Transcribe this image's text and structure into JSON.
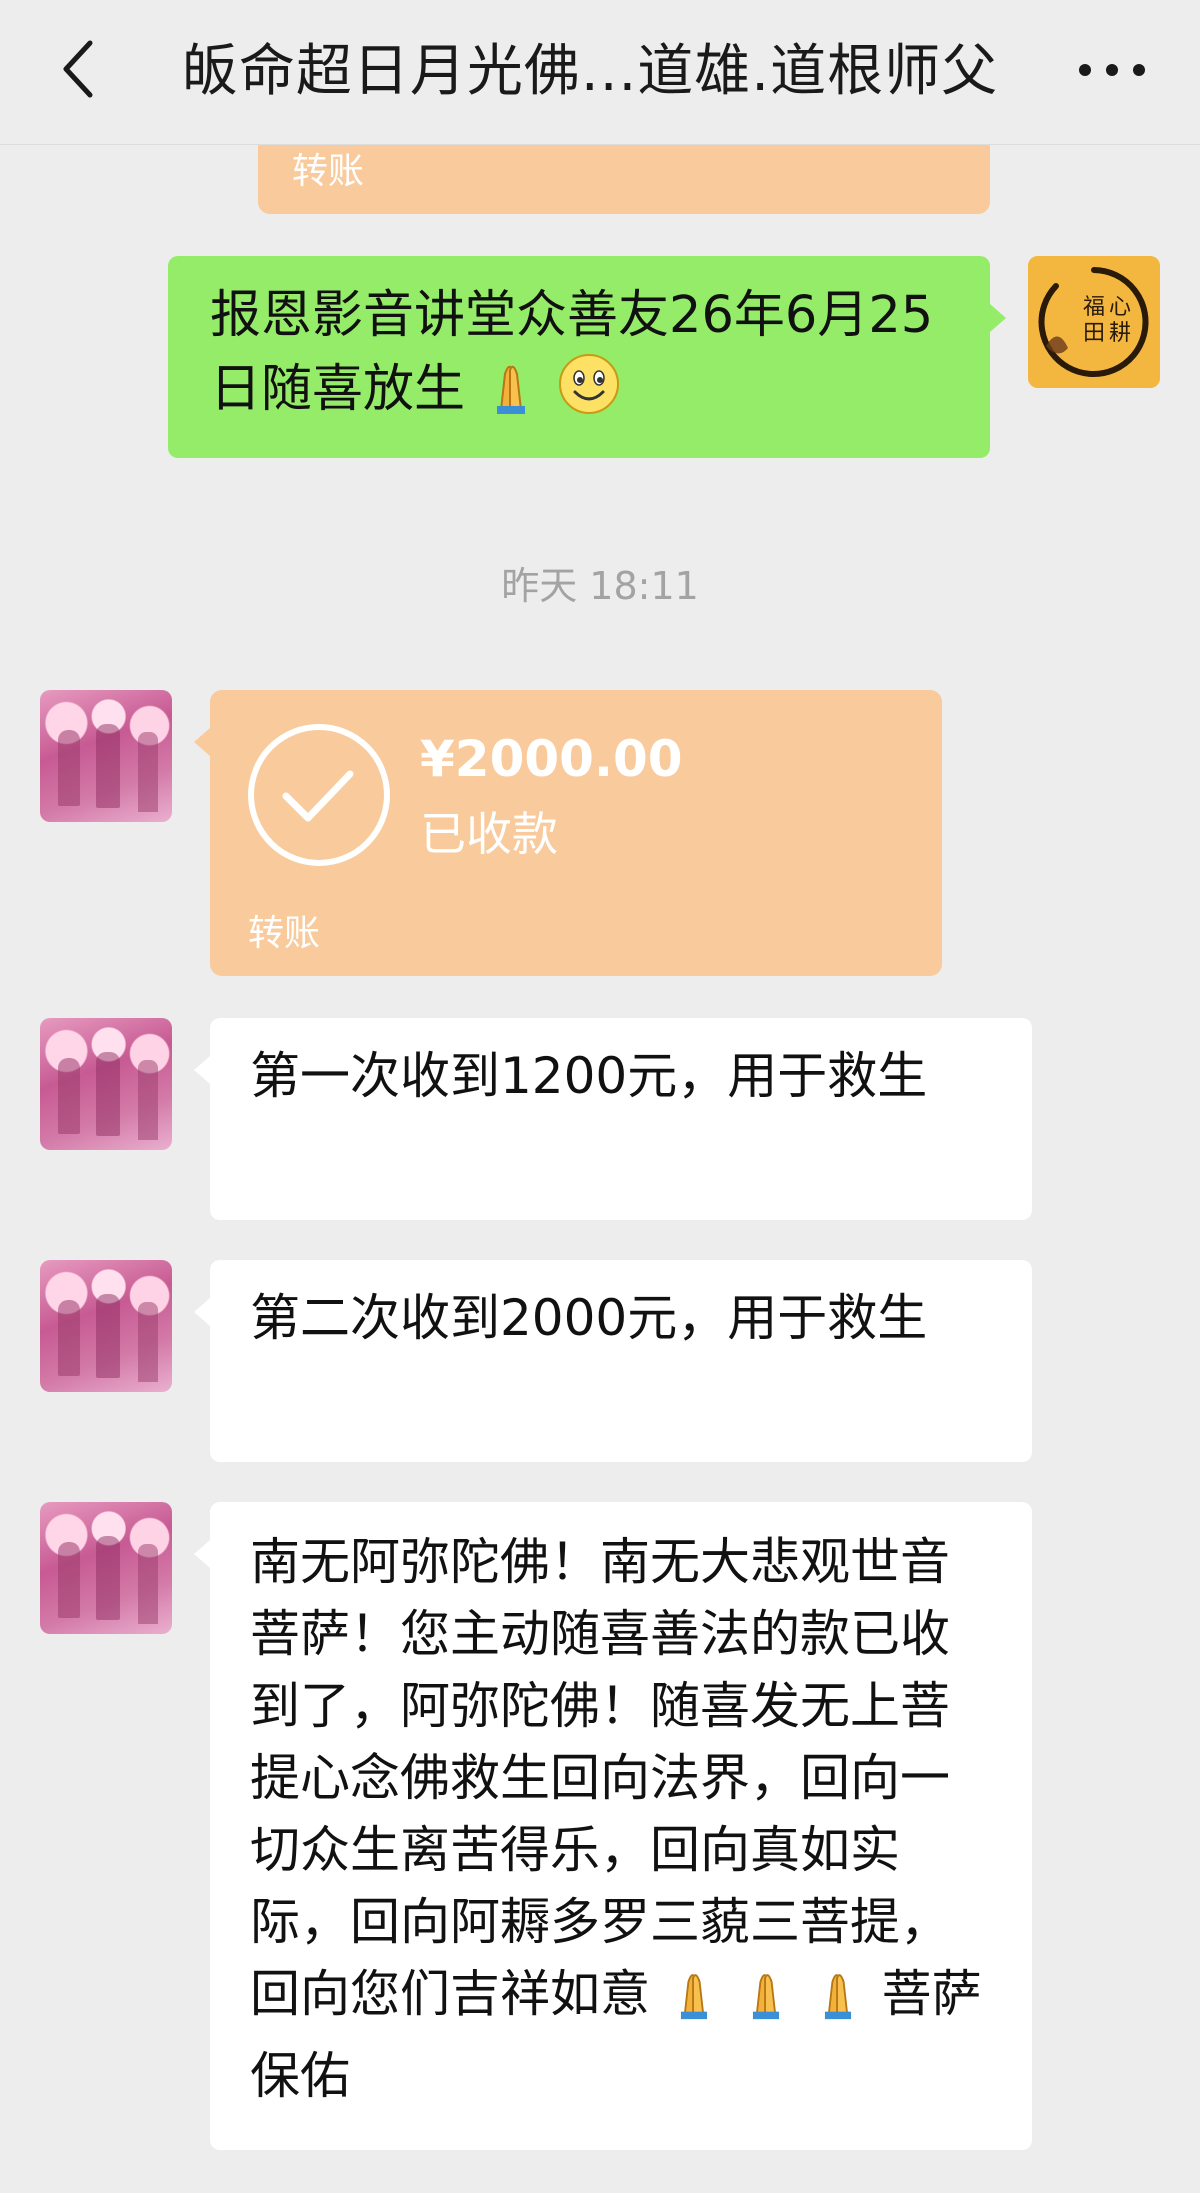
{
  "header": {
    "title": "皈命超日月光佛...道雄.道根师父"
  },
  "messages": {
    "prev_transfer_label": "转账",
    "outgoing_text": "报恩影音讲堂众善友26年6月25日随喜放生",
    "outgoing_emojis": [
      "folded-hands",
      "smiling-face"
    ],
    "timestamp": "昨天 18:11",
    "transfer": {
      "amount": "¥2000.00",
      "status": "已收款",
      "label": "转账"
    },
    "msg1": "第一次收到1200元，用于救生",
    "msg2": "第二次收到2000元，用于救生",
    "msg3": "南无阿弥陀佛！南无大悲观世音菩萨！您主动随喜善法的款已收到了，阿弥陀佛！随喜发无上菩提心念佛救生回向法界，回向一切众生离苦得乐，回向真如实际，回向阿耨多罗三藐三菩提，回向您们吉祥如意",
    "msg3_tail": "菩萨保佑",
    "self_avatar_text": "福田心耕"
  },
  "colors": {
    "background": "#ededed",
    "green_bubble": "#95ec69",
    "transfer_bg": "#f9cb9c",
    "white_bubble": "#ffffff"
  }
}
